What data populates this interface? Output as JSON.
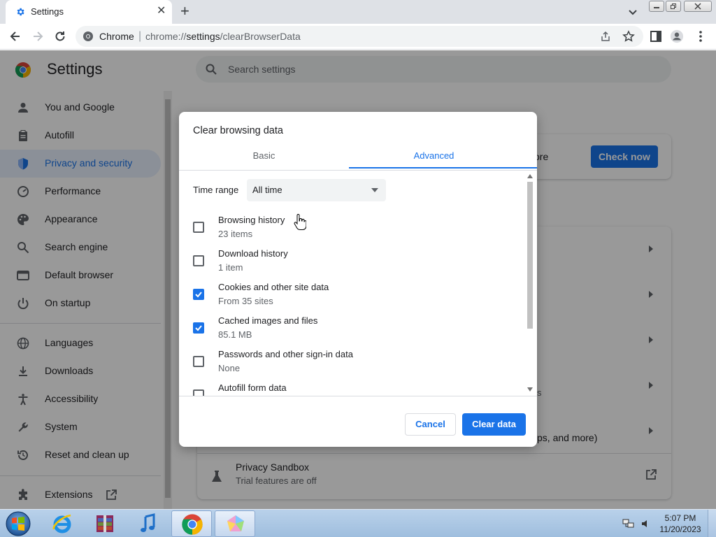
{
  "browser": {
    "tab_title": "Settings",
    "omnibox_site": "Chrome",
    "omnibox_url_prefix": "chrome://",
    "omnibox_url_host": "settings",
    "omnibox_url_path": "/clearBrowserData"
  },
  "settings": {
    "title": "Settings",
    "search_placeholder": "Search settings",
    "nav": [
      {
        "label": "You and Google",
        "icon": "person-icon"
      },
      {
        "label": "Autofill",
        "icon": "clipboard-icon"
      },
      {
        "label": "Privacy and security",
        "icon": "shield-icon",
        "active": true
      },
      {
        "label": "Performance",
        "icon": "gauge-icon"
      },
      {
        "label": "Appearance",
        "icon": "palette-icon"
      },
      {
        "label": "Search engine",
        "icon": "search-icon"
      },
      {
        "label": "Default browser",
        "icon": "browser-window-icon"
      },
      {
        "label": "On startup",
        "icon": "power-icon"
      },
      {
        "label": "Languages",
        "icon": "globe-icon"
      },
      {
        "label": "Downloads",
        "icon": "download-icon"
      },
      {
        "label": "Accessibility",
        "icon": "accessibility-icon"
      },
      {
        "label": "System",
        "icon": "wrench-icon"
      },
      {
        "label": "Reset and clean up",
        "icon": "history-icon"
      },
      {
        "label": "Extensions",
        "icon": "puzzle-icon"
      }
    ],
    "background": {
      "safety_check_partial": "ore",
      "check_now_label": "Check now",
      "row_partial_1": "s",
      "row_partial_2": "ps, and more)",
      "privacy_sandbox_title": "Privacy Sandbox",
      "privacy_sandbox_subtitle": "Trial features are off"
    }
  },
  "dialog": {
    "title": "Clear browsing data",
    "tabs": {
      "basic": "Basic",
      "advanced": "Advanced",
      "selected": "Advanced"
    },
    "time_range_label": "Time range",
    "time_range_value": "All time",
    "items": [
      {
        "title": "Browsing history",
        "subtitle": "23 items",
        "checked": false
      },
      {
        "title": "Download history",
        "subtitle": "1 item",
        "checked": false
      },
      {
        "title": "Cookies and other site data",
        "subtitle": "From 35 sites",
        "checked": true
      },
      {
        "title": "Cached images and files",
        "subtitle": "85.1 MB",
        "checked": true
      },
      {
        "title": "Passwords and other sign-in data",
        "subtitle": "None",
        "checked": false
      },
      {
        "title": "Autofill form data",
        "subtitle": "",
        "checked": false
      }
    ],
    "cancel_label": "Cancel",
    "clear_label": "Clear data"
  },
  "taskbar": {
    "time": "5:07 PM",
    "date": "11/20/2023",
    "apps": [
      "internet-explorer-icon",
      "archive-app-icon",
      "music-app-icon",
      "chrome-icon",
      "paint-app-icon"
    ]
  },
  "colors": {
    "accent": "#1a73e8",
    "active_nav_bg": "#e8f0fe",
    "overlay": "rgba(0,0,0,0.4)"
  }
}
